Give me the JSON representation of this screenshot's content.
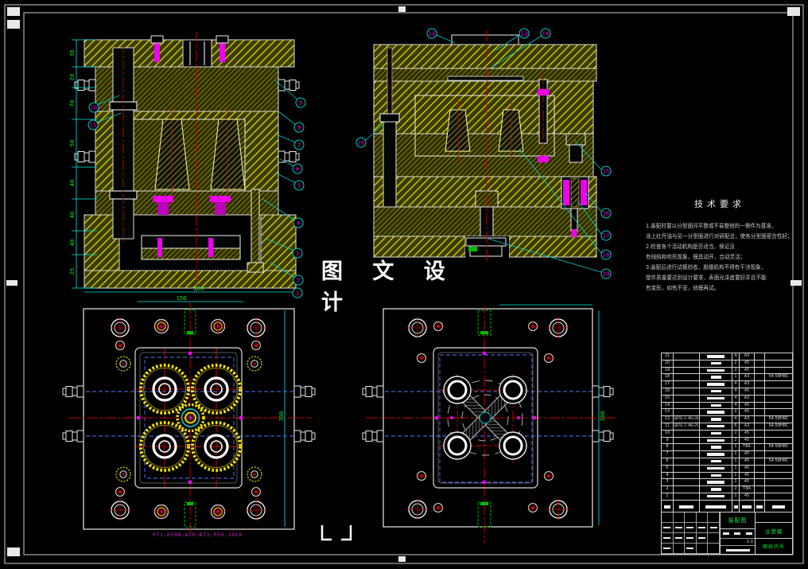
{
  "watermark": {
    "text": "图 文 设 计"
  },
  "tech_requirements": {
    "title": "技术要求",
    "lines": [
      "1.装配时要以分型面间平整或不易整修的一侧件为基准，",
      "涂上红丹油与另一分型面进行对研配合，使各分型面密合性好；",
      "2.检查各个活动机构是否适当，保证没",
      "有倾斜和咬死现象，模具动开，合动灵活；",
      "3.装配后进行试模验收，脱模机构不得有干涉现象，",
      "塑件质量要达到设计要求，表面光泽度要好并且不能",
      "有变形，如有不妥，修模再试。"
    ]
  },
  "mold_base_code": "PT1-0508-A50-B71-P50-1010",
  "dimensions": {
    "left_chain": [
      "30",
      "20",
      "70",
      "50",
      "40",
      "40",
      "40",
      "25"
    ],
    "plan_width": "280",
    "plan_inner_width": "150",
    "plan_height_left": "300",
    "plan_height_right": "300",
    "scale": "1:1"
  },
  "balloons": {
    "sl_right": [
      "9",
      "8",
      "7",
      "6",
      "5",
      "4",
      "3",
      "2"
    ],
    "sl_left": [
      "10",
      "11"
    ],
    "sr_top": [
      "12",
      "13",
      "14"
    ],
    "sr_left": [
      "20"
    ],
    "sr_right": [
      "15",
      "16",
      "17",
      "18",
      "19"
    ],
    "pl_top": [
      "1"
    ]
  },
  "colors": {
    "hatch_yellow": "#e3e300",
    "centerline_red": "#cc0000",
    "dimension_cyan": "#00e5e5",
    "dimension_text_green": "#00ee33",
    "detail_magenta": "#ee00ee",
    "cooling_blue": "#5577ff",
    "outline_white": "#eeeeee"
  },
  "bom": {
    "rows": [
      {
        "no": "21",
        "code": "",
        "qty": "4",
        "mat": "A3",
        "remark": ""
      },
      {
        "no": "20",
        "code": "",
        "qty": "2",
        "mat": "45",
        "remark": ""
      },
      {
        "no": "19",
        "code": "",
        "qty": "2",
        "mat": "45",
        "remark": ""
      },
      {
        "no": "18",
        "code": "",
        "qty": "1",
        "mat": "A3",
        "remark": "54-58HRC"
      },
      {
        "no": "17",
        "code": "",
        "qty": "4",
        "mat": "A3",
        "remark": ""
      },
      {
        "no": "16",
        "code": "",
        "qty": "4",
        "mat": "45",
        "remark": ""
      },
      {
        "no": "15",
        "code": "",
        "qty": "4",
        "mat": "A3",
        "remark": ""
      },
      {
        "no": "14",
        "code": "",
        "qty": "4",
        "mat": "45",
        "remark": ""
      },
      {
        "no": "13",
        "code": "",
        "qty": "2",
        "mat": "45",
        "remark": ""
      },
      {
        "no": "12",
        "code": "GB70.1-M6×20",
        "qty": "4",
        "mat": "A3",
        "remark": "54-58HRC"
      },
      {
        "no": "11",
        "code": "GB70.1-M8×25",
        "qty": "6",
        "mat": "A3",
        "remark": "54-58HRC"
      },
      {
        "no": "10",
        "code": "",
        "qty": "2",
        "mat": "45",
        "remark": ""
      },
      {
        "no": "9",
        "code": "",
        "qty": "2",
        "mat": "45",
        "remark": ""
      },
      {
        "no": "8",
        "code": "",
        "qty": "1",
        "mat": "T8A",
        "remark": "54-58HRC"
      },
      {
        "no": "7",
        "code": "",
        "qty": "1",
        "mat": "45",
        "remark": ""
      },
      {
        "no": "6",
        "code": "",
        "qty": "1",
        "mat": "45",
        "remark": "54-58HRC"
      },
      {
        "no": "5",
        "code": "",
        "qty": "1",
        "mat": "45",
        "remark": ""
      },
      {
        "no": "4",
        "code": "",
        "qty": "1",
        "mat": "45",
        "remark": ""
      },
      {
        "no": "3",
        "code": "",
        "qty": "1",
        "mat": "45",
        "remark": ""
      },
      {
        "no": "2",
        "code": "",
        "qty": "2",
        "mat": "T8A",
        "remark": ""
      },
      {
        "no": "1",
        "code": "",
        "qty": "1",
        "mat": "45",
        "remark": ""
      }
    ]
  },
  "title_block": {
    "drawing_name": "装配图",
    "type_label": "注塑模",
    "code_label": "图纸代号",
    "scale": "1:1"
  }
}
